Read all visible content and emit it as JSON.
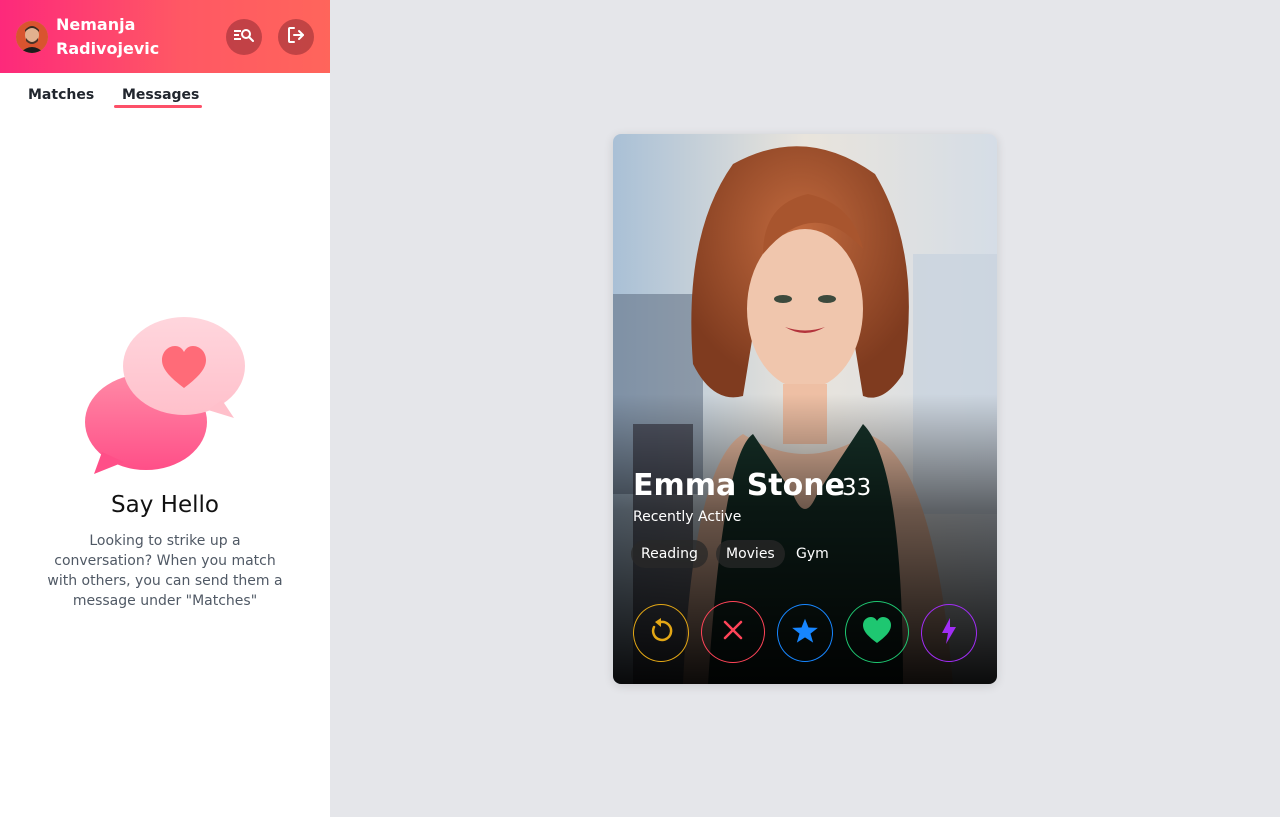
{
  "user": {
    "name": "Nemanja Radivojevic"
  },
  "tabs": [
    {
      "label": "Matches",
      "active": false
    },
    {
      "label": "Messages",
      "active": true
    }
  ],
  "empty_state": {
    "title": "Say Hello",
    "description": "Looking to strike up a conversation? When you match with others, you can send them a message under \"Matches\""
  },
  "card": {
    "name": "Emma Stone",
    "age": "33",
    "status": "Recently Active",
    "interests": [
      "Reading",
      "Movies",
      "Gym"
    ]
  },
  "actions": [
    {
      "name": "rewind",
      "icon": "rewind-icon",
      "color": "#e3a715"
    },
    {
      "name": "nope",
      "icon": "close-icon",
      "color": "#ff4458"
    },
    {
      "name": "super-like",
      "icon": "star-icon",
      "color": "#1786ff"
    },
    {
      "name": "like",
      "icon": "heart-icon",
      "color": "#1ec771"
    },
    {
      "name": "boost",
      "icon": "lightning-icon",
      "color": "#a12df5"
    }
  ],
  "colors": {
    "brand_gradient_start": "#fd297b",
    "brand_gradient_end": "#ff655b",
    "tab_underline": "#fd5068",
    "background": "#e5e6ea"
  }
}
